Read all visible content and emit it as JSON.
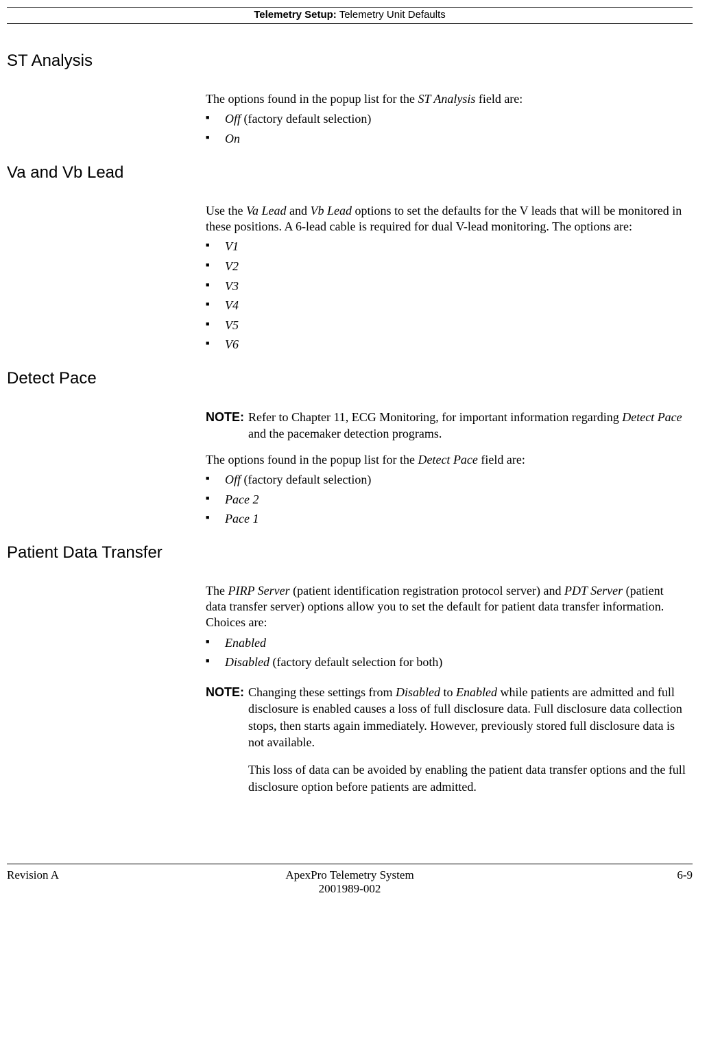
{
  "header": {
    "bold": "Telemetry Setup:",
    "rest": " Telemetry Unit Defaults"
  },
  "sections": {
    "st": {
      "heading": "ST Analysis",
      "intro_pre": "The options found in the popup list for the ",
      "intro_em": "ST Analysis",
      "intro_post": " field are:",
      "items": [
        {
          "em": "Off",
          "rest": " (factory default selection)"
        },
        {
          "em": "On",
          "rest": ""
        }
      ]
    },
    "va": {
      "heading": "Va and Vb Lead",
      "p_pre": "Use the ",
      "p_em1": "Va Lead",
      "p_mid1": " and ",
      "p_em2": "Vb Lead",
      "p_post": " options to set the defaults for the V leads that will be monitored in these positions. A 6-lead cable is required for dual V-lead monitoring. The options are:",
      "items": [
        "V1",
        "V2",
        "V3",
        "V4",
        "V5",
        "V6"
      ]
    },
    "detect": {
      "heading": "Detect Pace",
      "note_label": "NOTE:",
      "note_pre": "Refer to Chapter 11, ECG Monitoring, for important information regarding ",
      "note_em": "Detect Pace",
      "note_post": " and the pacemaker detection programs.",
      "intro_pre": "The options found in the popup list for the ",
      "intro_em": "Detect Pace",
      "intro_post": " field are:",
      "items": [
        {
          "em": "Off",
          "rest": " (factory default selection)"
        },
        {
          "em": "Pace 2",
          "rest": ""
        },
        {
          "em": "Pace 1",
          "rest": ""
        }
      ]
    },
    "pdt": {
      "heading": "Patient Data Transfer",
      "p_pre": "The ",
      "p_em1": "PIRP Server",
      "p_mid1": " (patient identification registration protocol server) and ",
      "p_em2": "PDT Server",
      "p_post": " (patient data transfer server) options allow you to set the default for patient data transfer information. Choices are:",
      "items": [
        {
          "em": "Enabled",
          "rest": ""
        },
        {
          "em": "Disabled",
          "rest": " (factory default selection for both)"
        }
      ],
      "note_label": "NOTE:",
      "note1_pre": "Changing these settings from ",
      "note1_em1": "Disabled",
      "note1_mid": " to ",
      "note1_em2": "Enabled",
      "note1_post": " while patients are admitted and full disclosure is enabled causes a loss of full disclosure data. Full disclosure data collection stops, then starts again immediately. However, previously stored full disclosure data is not available.",
      "note2": "This loss of data can be avoided by enabling the patient data transfer options and the full disclosure option before patients are admitted."
    }
  },
  "footer": {
    "left": "Revision A",
    "center1": "ApexPro Telemetry System",
    "center2": "2001989-002",
    "right": "6-9"
  }
}
